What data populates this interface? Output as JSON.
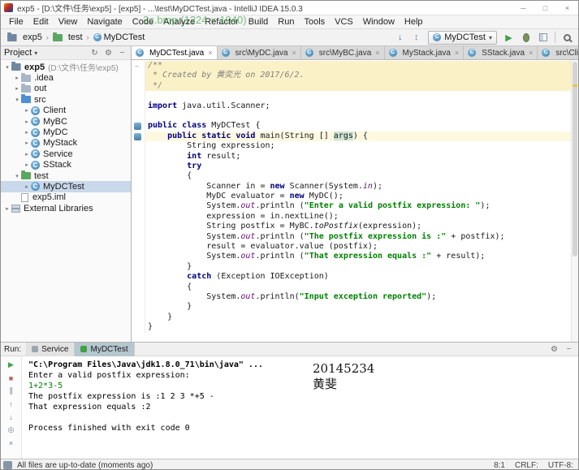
{
  "window": {
    "title": "exp5 - [D:\\文件\\任务\\exp5] - [exp5] - ...\\test\\MyDCTest.java - IntelliJ IDEA 15.0.3",
    "controls": [
      {
        "name": "minimize-button",
        "glyph": "─"
      },
      {
        "name": "maximize-button",
        "glyph": "□"
      },
      {
        "name": "close-button",
        "glyph": "×"
      }
    ]
  },
  "menu": [
    "File",
    "Edit",
    "View",
    "Navigate",
    "Code",
    "Analyze",
    "Refactor",
    "Build",
    "Run",
    "Tools",
    "VCS",
    "Window",
    "Help"
  ],
  "toolbar": {
    "breadcrumb": [
      {
        "label": "exp5",
        "icon": "project"
      },
      {
        "label": "test",
        "icon": "test"
      },
      {
        "label": "MyDCTest",
        "icon": "class"
      }
    ],
    "vcs_icons": [
      {
        "name": "vcs-update-icon",
        "glyph": "↓",
        "color": "#2e74c8"
      },
      {
        "name": "vcs-changes-icon",
        "glyph": "↕",
        "color": "#7d8893"
      }
    ],
    "run_config": "MyDCTest",
    "action_icons": [
      {
        "name": "run-button",
        "glyph": "▶",
        "color": "#3fa045",
        "cls": ""
      },
      {
        "name": "debug-button",
        "glyph": "",
        "color": "",
        "cls": "bug-shape"
      },
      {
        "name": "coverage-button",
        "glyph": "",
        "color": "",
        "cls": "cov-shape"
      }
    ]
  },
  "project_panel": {
    "header": "Project",
    "header_icons": [
      {
        "name": "sync-icon",
        "glyph": "↻"
      },
      {
        "name": "settings-icon",
        "glyph": "⚙"
      },
      {
        "name": "hide-icon",
        "glyph": "−"
      }
    ],
    "items": [
      {
        "depth": 0,
        "arrow": "down",
        "icon": "project",
        "label": "exp5",
        "extra": "(D:\\文件\\任务\\exp5)",
        "bold": true
      },
      {
        "depth": 1,
        "arrow": "right",
        "icon": "folder",
        "label": ".idea"
      },
      {
        "depth": 1,
        "arrow": "right",
        "icon": "folder",
        "label": "out"
      },
      {
        "depth": 1,
        "arrow": "down",
        "icon": "src",
        "label": "src"
      },
      {
        "depth": 2,
        "arrow": "right",
        "icon": "class",
        "label": "Client"
      },
      {
        "depth": 2,
        "arrow": "right",
        "icon": "class",
        "label": "MyBC"
      },
      {
        "depth": 2,
        "arrow": "right",
        "icon": "class",
        "label": "MyDC"
      },
      {
        "depth": 2,
        "arrow": "right",
        "icon": "class",
        "label": "MyStack"
      },
      {
        "depth": 2,
        "arrow": "right",
        "icon": "class",
        "label": "Service"
      },
      {
        "depth": 2,
        "arrow": "right",
        "icon": "class",
        "label": "SStack"
      },
      {
        "depth": 1,
        "arrow": "down",
        "icon": "test",
        "label": "test"
      },
      {
        "depth": 2,
        "arrow": "right",
        "icon": "class",
        "label": "MyDCTest",
        "selected": true
      },
      {
        "depth": 1,
        "arrow": "none",
        "icon": "file",
        "label": "exp5.iml"
      },
      {
        "depth": 0,
        "arrow": "right",
        "icon": "lib",
        "label": "External Libraries"
      }
    ]
  },
  "editor": {
    "tabs": [
      {
        "label": "MyDCTest.java",
        "active": true
      },
      {
        "label": "src\\MyDC.java",
        "active": false
      },
      {
        "label": "src\\MyBC.java",
        "active": false
      },
      {
        "label": "MyStack.java",
        "active": false
      },
      {
        "label": "SStack.java",
        "active": false
      },
      {
        "label": "src\\Client.java",
        "active": false
      }
    ],
    "lines": [
      {
        "gut": "fold",
        "bg": "cmt",
        "segs": [
          {
            "c": "cmt",
            "t": "/**"
          }
        ]
      },
      {
        "bg": "cmt",
        "segs": [
          {
            "c": "cmt",
            "t": " * Created by 黄奕光 on 2017/6/2."
          }
        ]
      },
      {
        "bg": "cmt",
        "segs": [
          {
            "c": "cmt",
            "t": " */"
          }
        ]
      },
      {
        "segs": []
      },
      {
        "segs": [
          {
            "c": "kw",
            "t": "import"
          },
          {
            "t": " java.util.Scanner;"
          }
        ]
      },
      {
        "segs": []
      },
      {
        "gut": "mark",
        "segs": [
          {
            "c": "kw",
            "t": "public class"
          },
          {
            "t": " MyDCTest {"
          }
        ]
      },
      {
        "gut": "mark",
        "bg": "caret",
        "segs": [
          {
            "c": "kw",
            "t": "    public static void"
          },
          {
            "t": " main(String [] "
          },
          {
            "c": "hl",
            "t": "args"
          },
          {
            "t": ") {"
          }
        ]
      },
      {
        "segs": [
          {
            "t": "        String expression;"
          }
        ]
      },
      {
        "segs": [
          {
            "c": "kw",
            "t": "        int"
          },
          {
            "t": " result;"
          }
        ]
      },
      {
        "segs": [
          {
            "c": "kw",
            "t": "        try"
          }
        ]
      },
      {
        "segs": [
          {
            "t": "        {"
          }
        ]
      },
      {
        "segs": [
          {
            "t": "            Scanner in = "
          },
          {
            "c": "kw",
            "t": "new"
          },
          {
            "t": " Scanner(System."
          },
          {
            "c": "fld",
            "t": "in"
          },
          {
            "t": ");"
          }
        ]
      },
      {
        "segs": [
          {
            "t": "            MyDC evaluator = "
          },
          {
            "c": "kw",
            "t": "new"
          },
          {
            "t": " MyDC();"
          }
        ]
      },
      {
        "segs": [
          {
            "t": "            System."
          },
          {
            "c": "fld",
            "t": "out"
          },
          {
            "t": ".println ("
          },
          {
            "c": "str",
            "t": "\"Enter a valid postfix expression: \""
          },
          {
            "t": ");"
          }
        ]
      },
      {
        "segs": [
          {
            "t": "            expression = in.nextLine();"
          }
        ]
      },
      {
        "segs": [
          {
            "t": "            String postfix = MyBC."
          },
          {
            "c": "it",
            "t": "toPostfix"
          },
          {
            "t": "(expression);"
          }
        ]
      },
      {
        "segs": [
          {
            "t": "            System."
          },
          {
            "c": "fld",
            "t": "out"
          },
          {
            "t": ".println ("
          },
          {
            "c": "str",
            "t": "\"The postfix expression is :\""
          },
          {
            "t": " + postfix);"
          }
        ]
      },
      {
        "segs": [
          {
            "t": "            result = evaluator.value (postfix);"
          }
        ]
      },
      {
        "segs": [
          {
            "t": "            System."
          },
          {
            "c": "fld",
            "t": "out"
          },
          {
            "t": ".println ("
          },
          {
            "c": "str",
            "t": "\"That expression equals :\""
          },
          {
            "t": " + result);"
          }
        ]
      },
      {
        "segs": [
          {
            "t": "        }"
          }
        ]
      },
      {
        "segs": [
          {
            "c": "kw",
            "t": "        catch"
          },
          {
            "t": " (Exception IOException)"
          }
        ]
      },
      {
        "segs": [
          {
            "t": "        {"
          }
        ]
      },
      {
        "segs": [
          {
            "t": "            System."
          },
          {
            "c": "fld",
            "t": "out"
          },
          {
            "t": ".println("
          },
          {
            "c": "str",
            "t": "\"Input exception reported\""
          },
          {
            "t": ");"
          }
        ]
      },
      {
        "segs": [
          {
            "t": "        }"
          }
        ]
      },
      {
        "segs": [
          {
            "t": "    }"
          }
        ]
      },
      {
        "segs": [
          {
            "t": "}"
          }
        ]
      }
    ]
  },
  "run_panel": {
    "label": "Run:",
    "tabs": [
      {
        "label": "Service",
        "active": false
      },
      {
        "label": "MyDCTest",
        "active": true
      }
    ],
    "toolbar_icons": [
      {
        "name": "rerun-icon",
        "glyph": "▶",
        "color": "#3fa045"
      },
      {
        "name": "stop-icon",
        "glyph": "■",
        "color": "#c0625e"
      },
      {
        "name": "pause-output-icon",
        "glyph": "∥",
        "color": "#6d7a86"
      },
      {
        "name": "jump-up-icon",
        "glyph": "↑",
        "color": "#6d7a86"
      },
      {
        "name": "jump-down-icon",
        "glyph": "↓",
        "color": "#6d7a86"
      },
      {
        "name": "pin-tab-icon",
        "glyph": "◎",
        "color": "#6d7a86"
      },
      {
        "name": "close-console-icon",
        "glyph": "×",
        "color": "#6d7a86"
      }
    ],
    "header_icons": [
      {
        "name": "settings-icon",
        "glyph": "⚙"
      },
      {
        "name": "hide-icon",
        "glyph": "−"
      }
    ],
    "console": [
      {
        "cls": "bold",
        "t": "\"C:\\Program Files\\Java\\jdk1.8.0_71\\bin\\java\" ..."
      },
      {
        "cls": "",
        "t": "Enter a valid postfix expression:"
      },
      {
        "cls": "green",
        "t": "1+2*3-5"
      },
      {
        "cls": "",
        "t": "The postfix expression is :1 2 3 *+5 -"
      },
      {
        "cls": "",
        "t": "That expression equals :2"
      },
      {
        "cls": "",
        "t": ""
      },
      {
        "cls": "",
        "t": "Process finished with exit code 0"
      }
    ]
  },
  "statusbar": {
    "left": "All files are up-to-date (moments ago)",
    "right": [
      "8:1",
      "CRLF:",
      "UTF-8:"
    ]
  },
  "watermarks": {
    "top": "2c.bmp (1224 × 1040)",
    "console_id": "20145234",
    "console_name": "黄斐"
  }
}
